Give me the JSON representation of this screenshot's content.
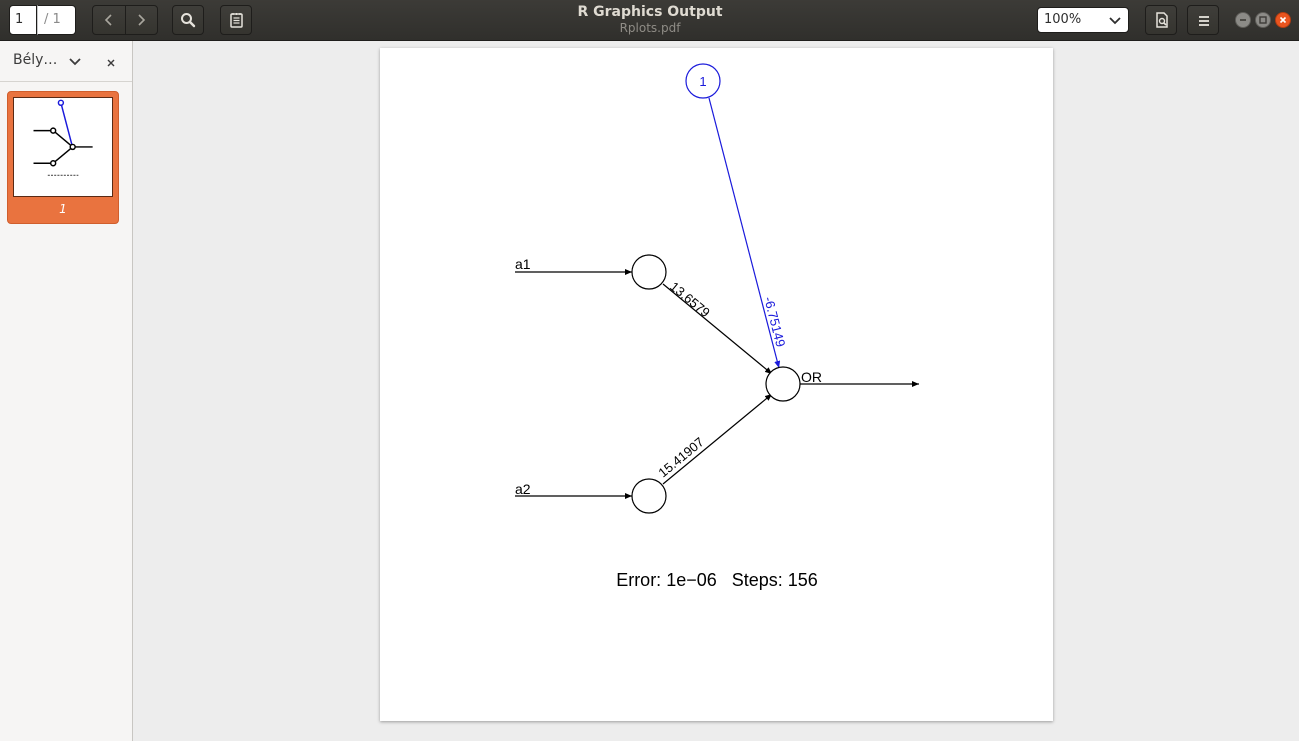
{
  "window": {
    "title": "R Graphics Output",
    "subtitle": "Rplots.pdf"
  },
  "toolbar": {
    "page_current": "1",
    "page_total": "/ 1",
    "zoom_value": "100%",
    "icons": [
      "chevron-left-icon",
      "chevron-right-icon",
      "search-icon",
      "annotations-icon",
      "document-properties-icon",
      "menu-icon"
    ]
  },
  "sidebar": {
    "title": "Bély…",
    "thumbnails": [
      {
        "label": "1"
      }
    ]
  },
  "plot": {
    "bias_node_label": "1",
    "inputs": [
      "a1",
      "a2"
    ],
    "output": "OR",
    "weights": {
      "a1_to_out": "13.6579",
      "a2_to_out": "15.41907",
      "bias_to_out": "-6.75149"
    },
    "error_text": "Error: 1e−06   Steps: 156",
    "colors": {
      "bias": "#1a1adb",
      "main": "#000000"
    }
  }
}
